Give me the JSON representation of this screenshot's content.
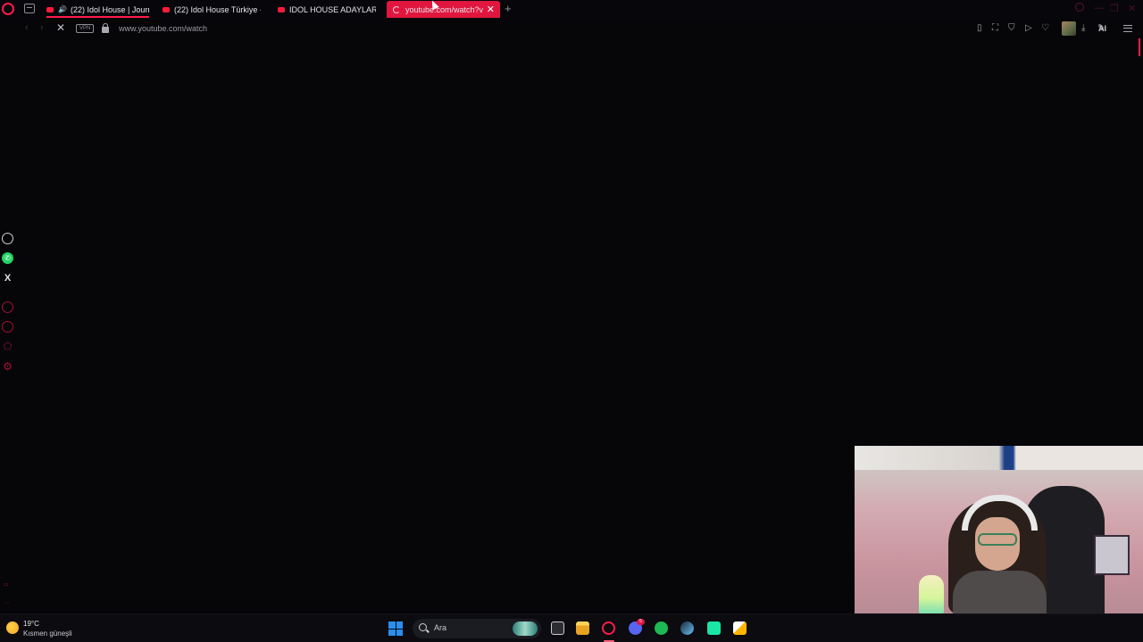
{
  "browser": {
    "tabs": [
      {
        "label": "(22) Idol House | Journ",
        "muted_icon": "🔊",
        "state": "background"
      },
      {
        "label": "(22) Idol House Türkiye -",
        "state": "background"
      },
      {
        "label": "IDOL HOUSE ADAYLARI -",
        "state": "background"
      },
      {
        "label": "youtube.com/watch?v",
        "state": "active-loading"
      }
    ],
    "close_glyph": "✕",
    "new_tab_glyph": "+",
    "address": {
      "vpn_label": "VPN",
      "url": "www.youtube.com/watch"
    },
    "toolbar": {
      "ai_label": "AI"
    },
    "accent_color": "#ff1b4b"
  },
  "sidebar": {
    "items": [
      "chatgpt-icon",
      "whatsapp-icon",
      "x-icon",
      "player-icon",
      "history-icon",
      "pinboard-icon",
      "settings-icon"
    ],
    "x_glyph": "X"
  },
  "taskbar": {
    "weather": {
      "temp": "19°C",
      "desc": "Kısmen güneşli"
    },
    "search_placeholder": "Ara",
    "discord_badge": "5"
  }
}
